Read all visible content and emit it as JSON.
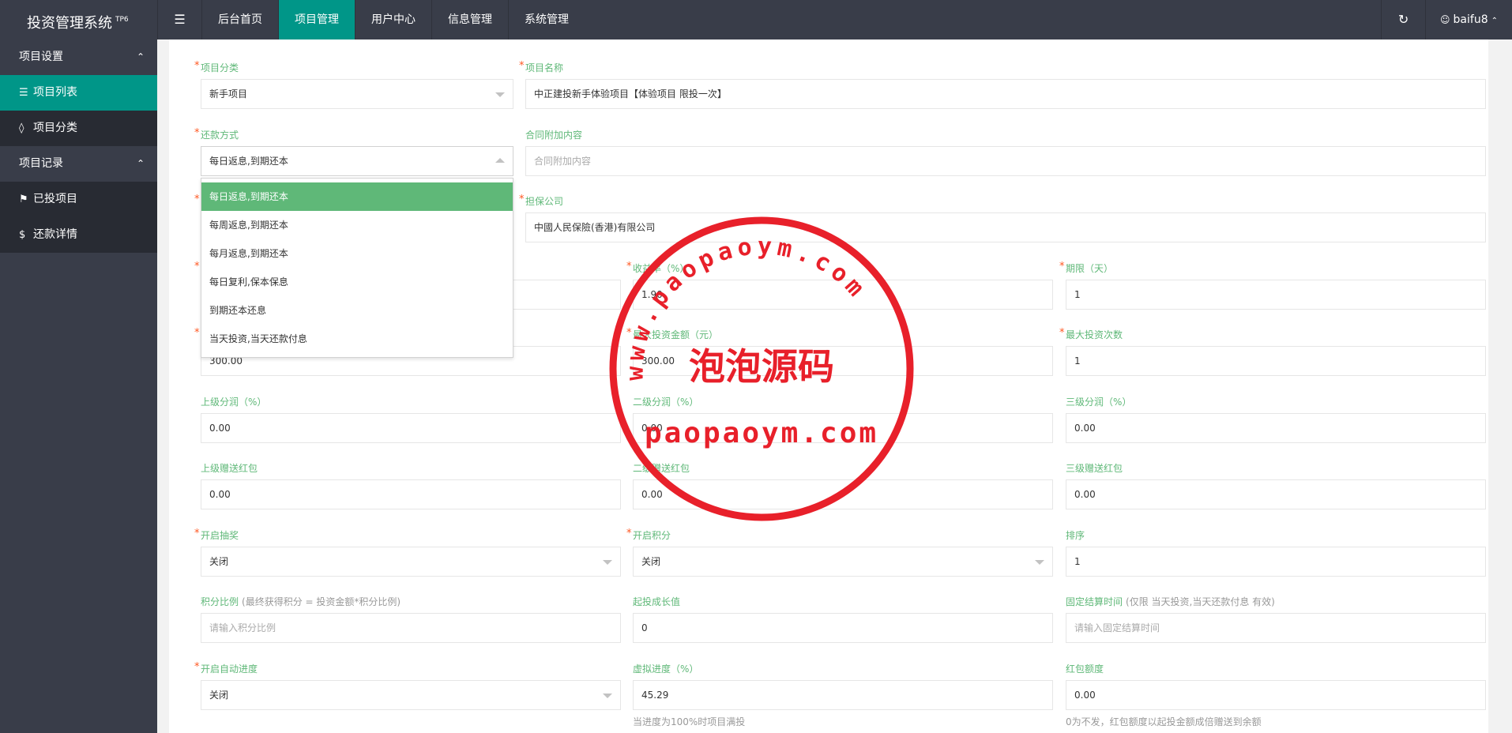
{
  "app": {
    "title": "投资管理系统",
    "badge": "TP6"
  },
  "nav": {
    "toggle_icon": "☰",
    "items": [
      "后台首页",
      "项目管理",
      "用户中心",
      "信息管理",
      "系统管理"
    ],
    "active": "项目管理"
  },
  "topright": {
    "refresh_icon": "↻",
    "user_icon": "👤",
    "username": "baifu8"
  },
  "sidebar": {
    "group1": "项目设置",
    "item1": "项目列表",
    "item2": "项目分类",
    "group2": "项目记录",
    "item3": "已投项目",
    "item4": "还款详情"
  },
  "form": {
    "category": {
      "label": "项目分类",
      "value": "新手项目"
    },
    "name": {
      "label": "项目名称",
      "value": "中正建投新手体验项目【体验项目 限投一次】"
    },
    "repay": {
      "label": "还款方式",
      "value": "每日返息,到期还本"
    },
    "contract": {
      "label": "合同附加内容",
      "placeholder": "合同附加内容"
    },
    "guarantor": {
      "label": "担保公司",
      "value": "中國人民保險(香港)有限公司"
    },
    "rate": {
      "label": "收益率（%）",
      "value": "1.90"
    },
    "period": {
      "label": "期限（天）",
      "value": "1"
    },
    "min_amount": {
      "value": "300.00"
    },
    "max_amount": {
      "label": "最大投资金额（元）",
      "value": "300.00"
    },
    "max_times": {
      "label": "最大投资次数",
      "value": "1"
    },
    "share1": {
      "label": "上级分润（%）",
      "value": "0.00"
    },
    "share2": {
      "label": "二级分润（%）",
      "value": "0.00"
    },
    "share3": {
      "label": "三级分润（%）",
      "value": "0.00"
    },
    "gift1": {
      "label": "上级赠送红包",
      "value": "0.00"
    },
    "gift2": {
      "label": "二级赠送红包",
      "value": "0.00"
    },
    "gift3": {
      "label": "三级赠送红包",
      "value": "0.00"
    },
    "lottery": {
      "label": "开启抽奖",
      "value": "关闭"
    },
    "points": {
      "label": "开启积分",
      "value": "关闭"
    },
    "sort": {
      "label": "排序",
      "value": "1"
    },
    "ratio": {
      "label": "积分比例",
      "hint": "(最终获得积分 = 投资金额*积分比例)",
      "placeholder": "请输入积分比例"
    },
    "growth": {
      "label": "起投成长值",
      "value": "0"
    },
    "settle": {
      "label": "固定结算时间",
      "hint": "(仅限 当天投资,当天还款付息 有效)",
      "placeholder": "请输入固定结算时间"
    },
    "auto_progress": {
      "label": "开启自动进度",
      "value": "关闭"
    },
    "virtual_progress": {
      "label": "虚拟进度（%）",
      "value": "45.29",
      "note": "当进度为100%时项目满投"
    },
    "redpack": {
      "label": "红包额度",
      "value": "0.00",
      "note": "0为不发，红包额度以起投金额成倍赠送到余额"
    }
  },
  "dropdown_options": [
    "每日返息,到期还本",
    "每周返息,到期还本",
    "每月返息,到期还本",
    "每日复利,保本保息",
    "到期还本还息",
    "当天投资,当天还款付息"
  ],
  "stamp": {
    "arc_text": "www.paopaoym.com",
    "center_text": "泡泡源码",
    "bottom_text": "paopaoym.com",
    "color": "#e8202a"
  }
}
